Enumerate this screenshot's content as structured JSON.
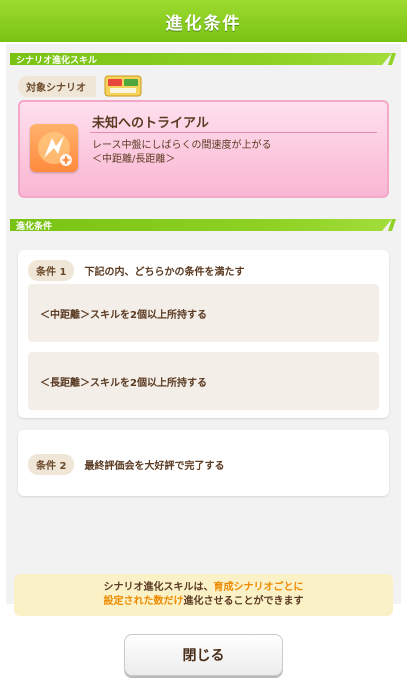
{
  "header": {
    "title": "進化条件"
  },
  "section_skill": {
    "label": "シナリオ進化スキル"
  },
  "scenario": {
    "tag": "対象シナリオ",
    "logo_icon": "scenario-logo-icon"
  },
  "skill": {
    "icon": "speed-skill-icon",
    "title": "未知へのトライアル",
    "desc_line1": "レース中盤にしばらくの間速度が上がる",
    "desc_line2": "＜中距離/長距離＞"
  },
  "section_cond": {
    "label": "進化条件"
  },
  "condition1": {
    "badge": "条件 1",
    "text": "下記の内、どちらかの条件を満たす",
    "options": [
      "＜中距離＞スキルを2個以上所持する",
      "＜長距離＞スキルを2個以上所持する"
    ]
  },
  "condition2": {
    "badge": "条件 2",
    "text": "最終評価会を大好評で完了する"
  },
  "note": {
    "l1_a": "シナリオ進化スキルは、",
    "l1_b": "育成シナリオごとに",
    "l2_a": "設定された数だけ",
    "l2_b": "進化させることができます"
  },
  "footer": {
    "close_label": "閉じる"
  },
  "colors": {
    "accent_green": "#79c214",
    "pink": "#f9b6d2",
    "orange_text": "#ee8a00"
  }
}
